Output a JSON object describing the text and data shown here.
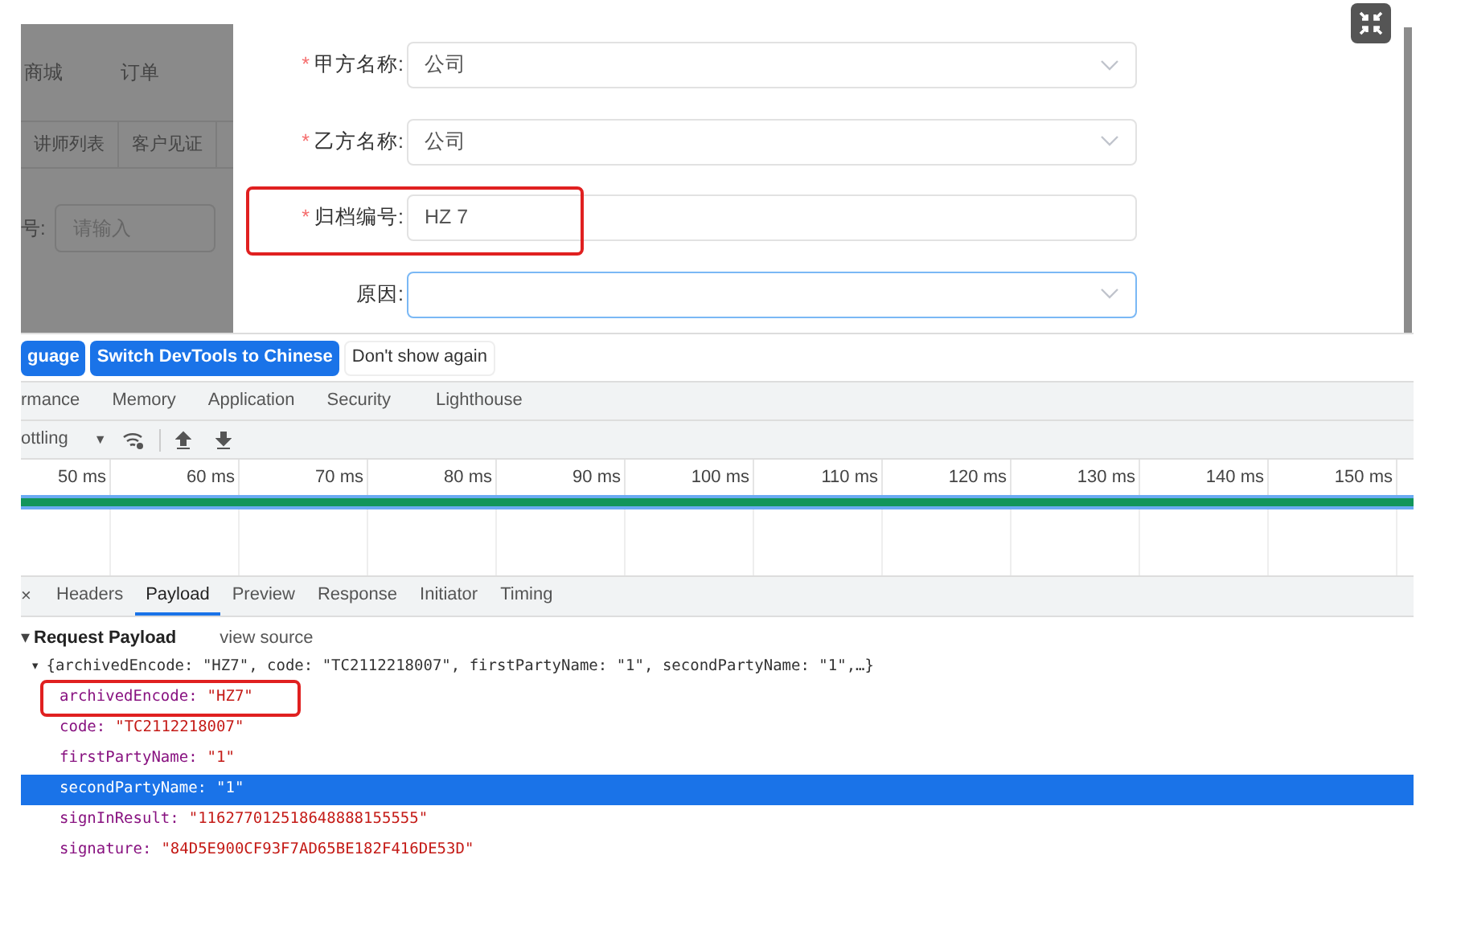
{
  "background_page": {
    "nav": [
      "商城",
      "订单"
    ],
    "tabs": [
      "讲师列表",
      "客户见证"
    ],
    "filter": {
      "label": "号:",
      "placeholder": "请输入"
    }
  },
  "dialog": {
    "fields": [
      {
        "label": "甲方名称:",
        "required_mark": "*",
        "kind": "select",
        "value": "公司",
        "focused": false,
        "highlighted": false
      },
      {
        "label": "乙方名称:",
        "required_mark": "*",
        "kind": "select",
        "value": "公司",
        "focused": false,
        "highlighted": false
      },
      {
        "label": "归档编号:",
        "required_mark": "*",
        "kind": "input",
        "value": "HZ 7",
        "focused": false,
        "highlighted": true
      },
      {
        "label": "原因:",
        "kind": "select",
        "focused": true,
        "highlighted": false
      }
    ]
  },
  "devtools": {
    "language_bar": [
      {
        "label": "guage",
        "kind": "primary"
      },
      {
        "label": "Switch DevTools to Chinese",
        "kind": "primary"
      },
      {
        "label": "Don't show again",
        "kind": "plain"
      }
    ],
    "panel_tabs": [
      "rmance",
      "Memory",
      "Application",
      "Security",
      "Lighthouse"
    ],
    "throttling": {
      "label": "ottling",
      "caret": "▼"
    },
    "timeline_ticks": [
      "50 ms",
      "60 ms",
      "70 ms",
      "80 ms",
      "90 ms",
      "100 ms",
      "110 ms",
      "120 ms",
      "130 ms",
      "140 ms",
      "150 ms"
    ],
    "request_tabs": [
      {
        "label": "Headers",
        "selected": false
      },
      {
        "label": "Payload",
        "selected": true
      },
      {
        "label": "Preview",
        "selected": false
      },
      {
        "label": "Response",
        "selected": false
      },
      {
        "label": "Initiator",
        "selected": false
      },
      {
        "label": "Timing",
        "selected": false
      }
    ],
    "close": "×",
    "payload": {
      "expander": "▾",
      "title": "Request Payload",
      "view_source": "view source",
      "summary_expander": "▾",
      "summary": "{archivedEncode: \"HZ7\", code: \"TC2112218007\", firstPartyName: \"1\", secondPartyName: \"1\",…}",
      "lines": [
        {
          "key": "archivedEncode:",
          "value": "\"HZ7\"",
          "selected": false,
          "highlighted": true
        },
        {
          "key": "code:",
          "value": "\"TC2112218007\"",
          "selected": false,
          "highlighted": false
        },
        {
          "key": "firstPartyName:",
          "value": "\"1\"",
          "selected": false,
          "highlighted": false
        },
        {
          "key": "secondPartyName:",
          "value": "\"1\"",
          "selected": true,
          "highlighted": false
        },
        {
          "key": "signInResult:",
          "value": "\"116277012518648888155555\"",
          "selected": false,
          "highlighted": false
        },
        {
          "key": "signature:",
          "value": "\"84D5E900CF93F7AD65BE182F416DE53D\"",
          "selected": false,
          "highlighted": false
        }
      ]
    }
  }
}
